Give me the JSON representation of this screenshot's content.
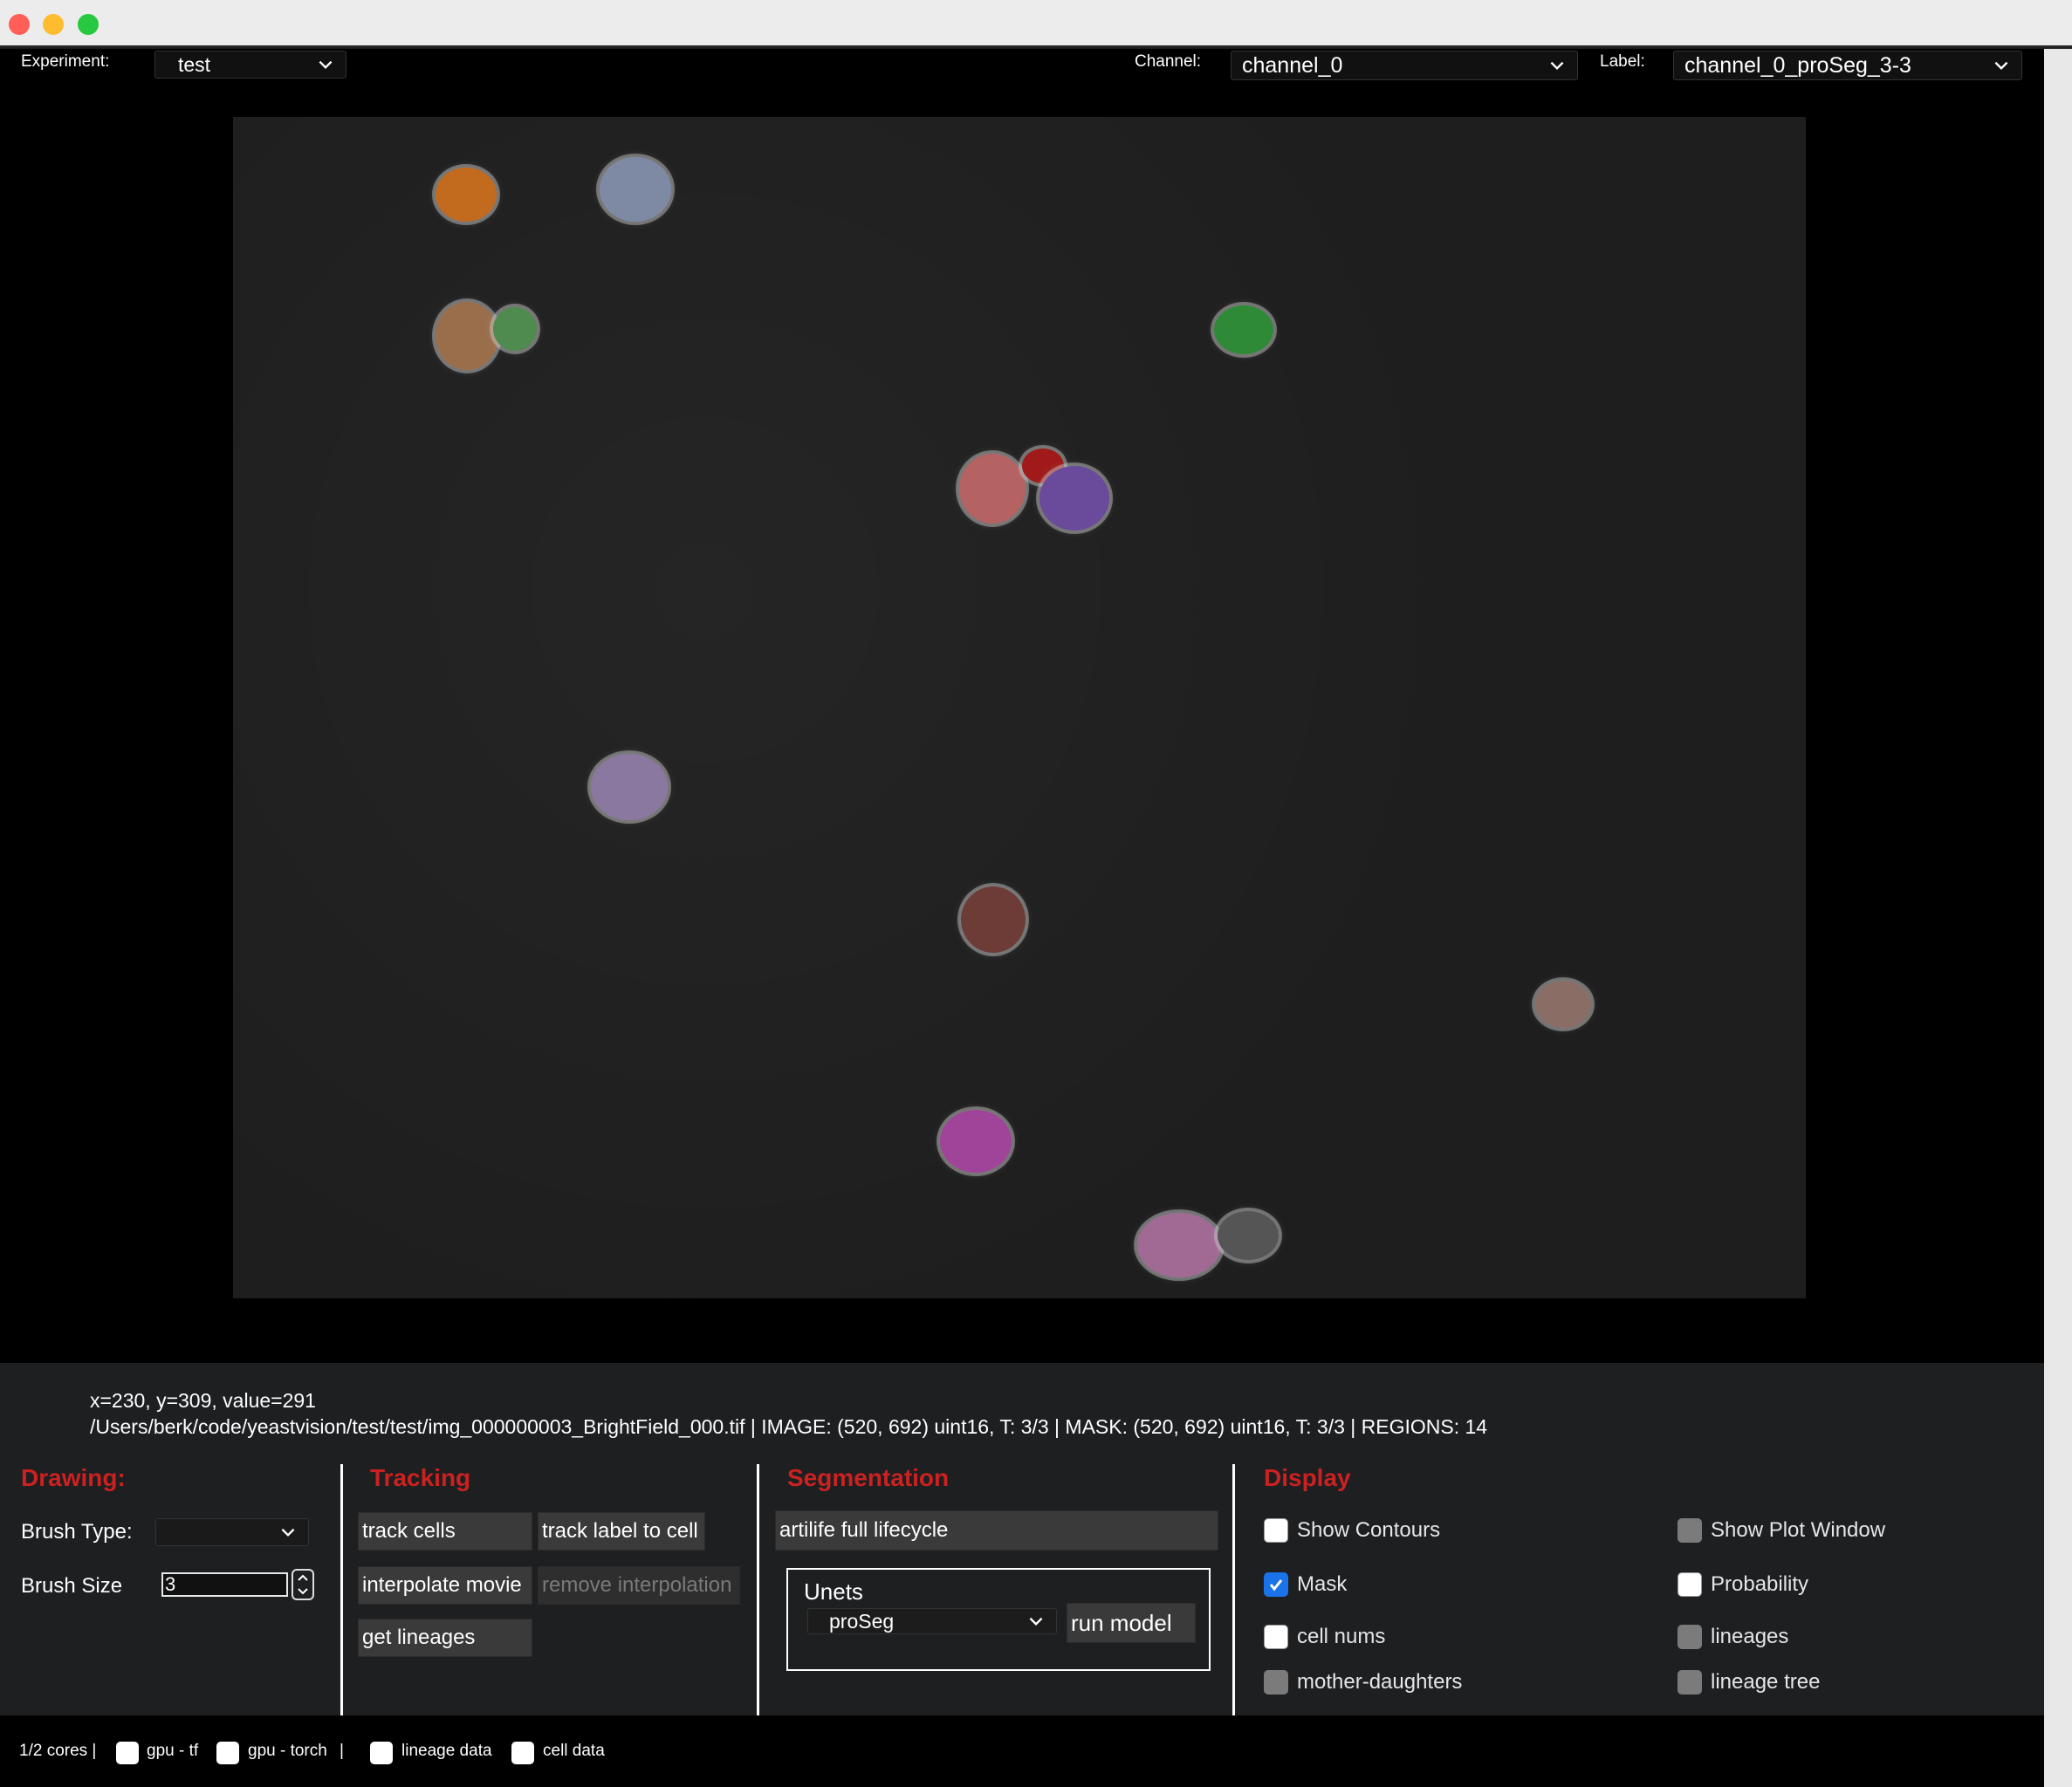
{
  "window": {
    "traffic_lights": {
      "close_color": "#ff5f57",
      "minimize_color": "#febc2e",
      "zoom_color": "#28c840"
    }
  },
  "top": {
    "experiment_label": "Experiment:",
    "experiment_value": "test",
    "channel_label": "Channel:",
    "channel_value": "channel_0",
    "label_label": "Label:",
    "label_value": "channel_0_proSeg_3-3"
  },
  "status": {
    "cursor": "x=230, y=309, value=291",
    "file_info": "/Users/berk/code/yeastvision/test/test/img_000000003_BrightField_000.tif | IMAGE: (520, 692) uint16, T: 3/3  |  MASK: (520, 692) uint16, T: 3/3  |  REGIONS: 14"
  },
  "drawing": {
    "title": "Drawing:",
    "brush_type_label": "Brush Type:",
    "brush_type_value": "",
    "brush_size_label": "Brush Size",
    "brush_size_value": "3"
  },
  "tracking": {
    "title": "Tracking",
    "track_cells": "track cells",
    "track_label_to_cell": "track label to cell",
    "interpolate_movie": "interpolate movie",
    "remove_interpolation": "remove interpolation",
    "get_lineages": "get lineages"
  },
  "segmentation": {
    "title": "Segmentation",
    "model_family": "artilife full lifecycle",
    "group_title": "Unets",
    "model_value": "proSeg",
    "run_model": "run model"
  },
  "display": {
    "title": "Display",
    "options": [
      {
        "label": "Show Contours",
        "checked": false,
        "enabled": true
      },
      {
        "label": "Show Plot Window",
        "checked": false,
        "enabled": false
      },
      {
        "label": "Mask",
        "checked": true,
        "enabled": true
      },
      {
        "label": "Probability",
        "checked": false,
        "enabled": true
      },
      {
        "label": "cell nums",
        "checked": false,
        "enabled": true
      },
      {
        "label": "lineages",
        "checked": false,
        "enabled": false
      },
      {
        "label": "mother-daughters",
        "checked": false,
        "enabled": false
      },
      {
        "label": "lineage tree",
        "checked": false,
        "enabled": false
      }
    ]
  },
  "bottom": {
    "cores": "1/2 cores |",
    "gpu_tf": "gpu - tf",
    "gpu_torch": "gpu - torch",
    "sep": "|",
    "lineage_data": "lineage data",
    "cell_data": "cell data"
  },
  "colors": {
    "section_title": "#cc2121",
    "checkbox_checked": "#1a73e8"
  }
}
